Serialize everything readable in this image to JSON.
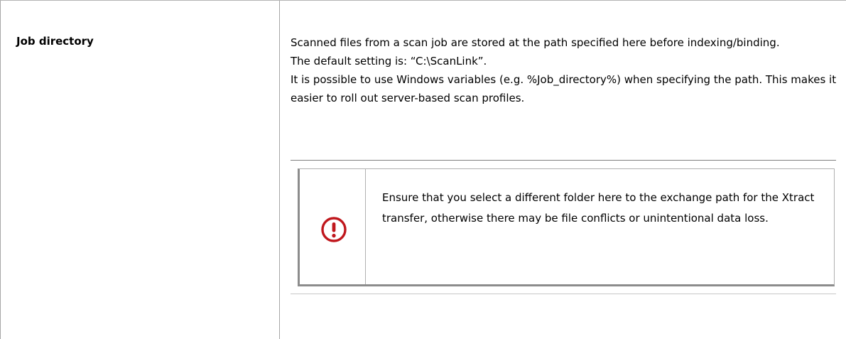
{
  "table": {
    "row_label": "Job directory",
    "description": {
      "line_1": "Scanned files from a scan job are stored at the path specified here before indexing/binding.",
      "line_2": "The default setting is: “C:\\ScanLink”.",
      "line_3": "It is possible to use Windows variables (e.g. %Job_directory%) when specifying the path. This makes it easier to roll out server-based scan profiles."
    },
    "note": {
      "icon": "alert-circle-icon",
      "icon_color": "#c0171d",
      "text": "Ensure that you select a different folder here to the exchange path for the Xtract transfer, otherwise there may be file conflicts or unintentional data loss."
    }
  }
}
